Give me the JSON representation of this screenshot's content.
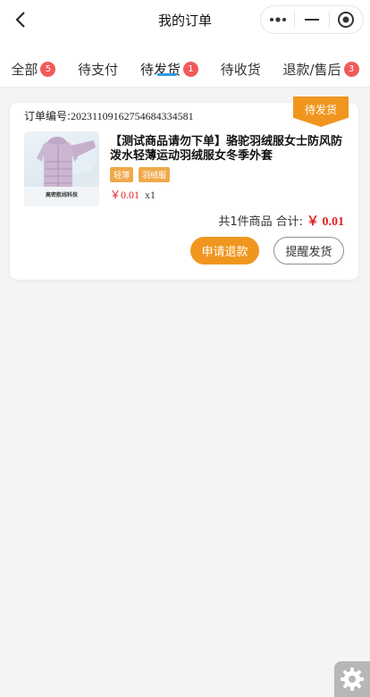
{
  "header": {
    "title": "我的订单"
  },
  "tabs": [
    {
      "label": "全部",
      "badge": "5"
    },
    {
      "label": "待支付",
      "badge": ""
    },
    {
      "label": "待发货",
      "badge": "1",
      "active": true
    },
    {
      "label": "待收货",
      "badge": ""
    },
    {
      "label": "退款/售后",
      "badge": "3"
    }
  ],
  "order": {
    "number_label": "订单编号:",
    "number": "20231109162754684334581",
    "status": "待发货",
    "product_title": "【测试商品请勿下单】骆驼羽绒服女士防风防泼水轻薄运动羽绒服女冬季外套",
    "tags": [
      "轻薄",
      "羽绒服"
    ],
    "price": "￥0.01",
    "quantity": "x1",
    "summary_count": "共1件商品",
    "summary_total_label": "合计:",
    "summary_total": "￥ 0.01",
    "thumb_caption": "高密航线科技",
    "actions": {
      "refund": "申请退款",
      "remind": "提醒发货"
    }
  },
  "colors": {
    "accent_orange": "#f0961f",
    "price_red": "#e02020",
    "badge_red": "#f05a5a",
    "tab_underline": "#2f9be6"
  },
  "icons": {
    "back": "chevron-left-icon",
    "more": "more-dots-icon",
    "minimize": "minimize-icon",
    "close": "close-target-icon",
    "settings": "gear-icon"
  }
}
